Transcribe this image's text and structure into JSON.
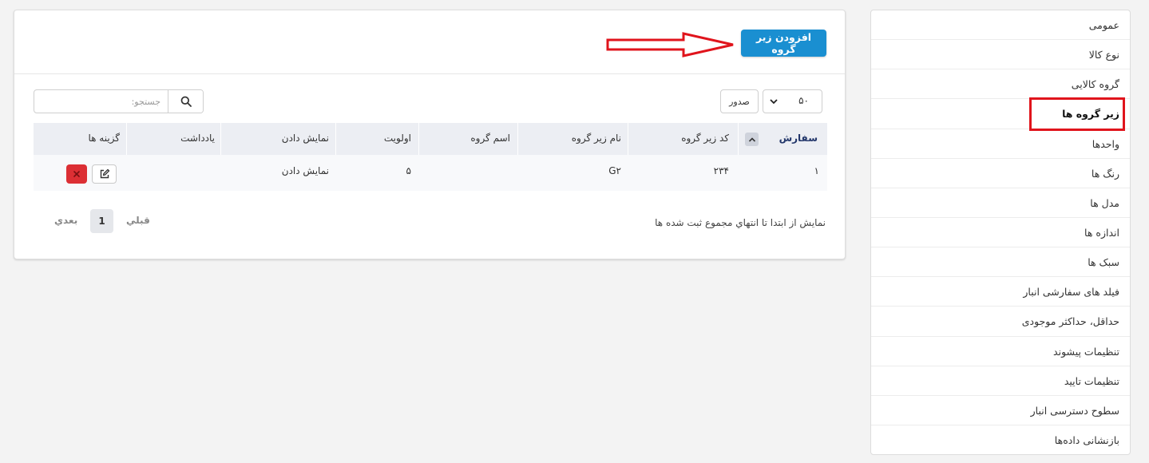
{
  "sidebar": {
    "items": [
      {
        "label": "عمومی"
      },
      {
        "label": "نوع کالا"
      },
      {
        "label": "گروه کالایی"
      },
      {
        "label": "زیر گروه ها"
      },
      {
        "label": "واحدها"
      },
      {
        "label": "رنگ ها"
      },
      {
        "label": "مدل ها"
      },
      {
        "label": "اندازه ها"
      },
      {
        "label": "سبک ها"
      },
      {
        "label": "فیلد های سفارشی انبار"
      },
      {
        "label": "حداقل، حداکثر موجودی"
      },
      {
        "label": "تنظیمات پیشوند"
      },
      {
        "label": "تنظیمات تایید"
      },
      {
        "label": "سطوح دسترسی انبار"
      },
      {
        "label": "بازنشانی دادەها"
      }
    ],
    "active_index": 3
  },
  "header": {
    "add_button_label": "افزودن زیر گروه"
  },
  "controls": {
    "page_size": "۵۰",
    "export_label": "صدور",
    "search_placeholder": "جستجو:"
  },
  "table": {
    "columns": [
      "سفارش",
      "کد زیر گروه",
      "نام زیر گروه",
      "اسم گروه",
      "اولویت",
      "نمایش دادن",
      "یادداشت",
      "گزینه ها"
    ],
    "rows": [
      {
        "order": "۱",
        "code": "۲۳۴",
        "name": "G۲",
        "group": "",
        "priority": "۵",
        "display": "نمایش دادن",
        "note": ""
      }
    ]
  },
  "footer": {
    "info": "نمايش از ابتدا تا انتهاي مجموع ثبت شده ها",
    "prev": "قبلي",
    "current_page": "1",
    "next": "بعدي"
  },
  "colors": {
    "accent": "#1a8fd1",
    "danger": "#dc2f34",
    "annotation": "#e0141c"
  }
}
